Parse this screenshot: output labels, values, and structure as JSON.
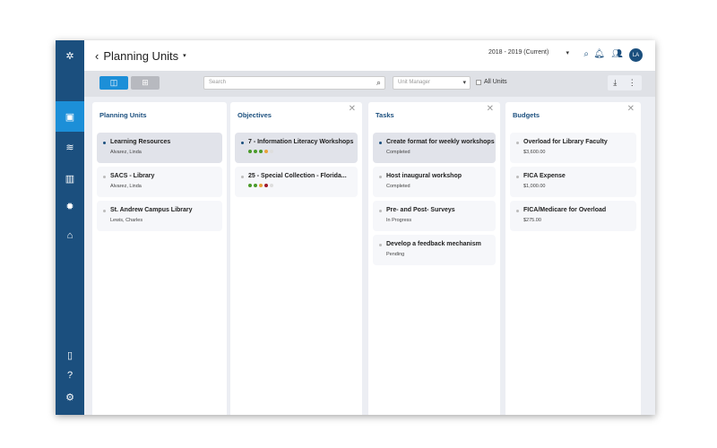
{
  "header": {
    "title": "Planning Units",
    "year": "2018 - 2019 (Current)",
    "avatar": "LA"
  },
  "toolbar": {
    "search_placeholder": "Search",
    "manager_placeholder": "Unit Manager",
    "all_units": "All Units"
  },
  "sidebar": {
    "items": [
      {
        "icon": "calendar-check-icon",
        "active": true
      },
      {
        "icon": "coins-icon"
      },
      {
        "icon": "bar-chart-icon"
      },
      {
        "icon": "badge-icon"
      },
      {
        "icon": "institution-icon"
      },
      {
        "icon": "book-icon"
      },
      {
        "icon": "help-icon"
      },
      {
        "icon": "settings-icon"
      }
    ]
  },
  "columns": [
    {
      "title": "Planning Units",
      "items": [
        {
          "title": "Learning Resources",
          "sub": "Alvarez, Linda",
          "selected": true
        },
        {
          "title": "SACS - Library",
          "sub": "Alvarez, Linda"
        },
        {
          "title": "St. Andrew Campus Library",
          "sub": "Lewis, Charles"
        }
      ]
    },
    {
      "title": "Objectives",
      "items": [
        {
          "title": "7 - Information Literacy Workshops",
          "selected": true,
          "dots": [
            "#4a9a2a",
            "#4a9a2a",
            "#4a9a2a",
            "#e8a23a",
            "#dddddd"
          ]
        },
        {
          "title": "25 - Special Collection - Florida...",
          "dots": [
            "#4a9a2a",
            "#4a9a2a",
            "#e8a23a",
            "#a01a2a",
            "#dddddd"
          ]
        }
      ]
    },
    {
      "title": "Tasks",
      "items": [
        {
          "title": "Create format for weekly workshops",
          "sub": "Completed",
          "selected": true
        },
        {
          "title": "Host inaugural workshop",
          "sub": "Completed"
        },
        {
          "title": "Pre- and Post- Surveys",
          "sub": "In Progress"
        },
        {
          "title": "Develop a feedback mechanism",
          "sub": "Pending"
        }
      ]
    },
    {
      "title": "Budgets",
      "items": [
        {
          "title": "Overload for Library Faculty",
          "sub": "$3,600.00"
        },
        {
          "title": "FICA Expense",
          "sub": "$1,000.00"
        },
        {
          "title": "FICA/Medicare for Overload",
          "sub": "$275.00"
        }
      ]
    }
  ]
}
